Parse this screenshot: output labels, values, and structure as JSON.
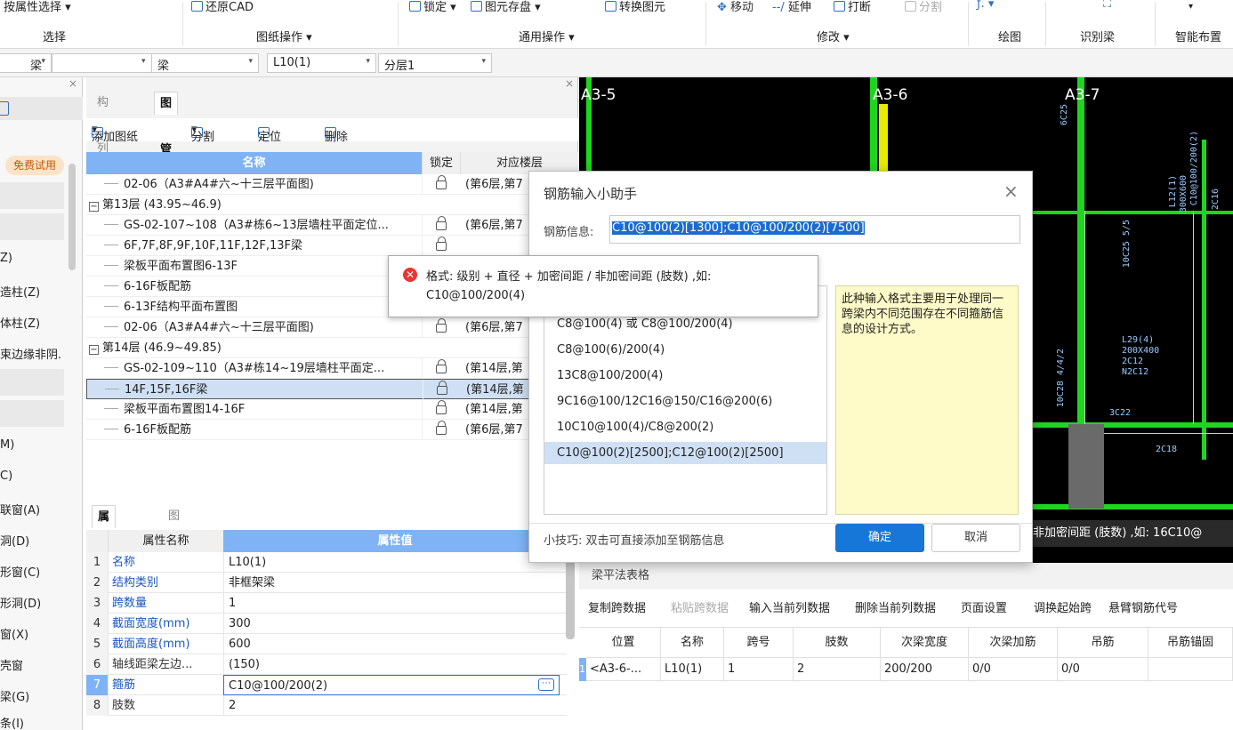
{
  "ribbon": {
    "groups": {
      "select": "选择",
      "drawing_ops": "图纸操作",
      "common_ops": "通用操作",
      "modify": "修改",
      "draw": "绘图",
      "recognize_beam": "识别梁",
      "smart_layout": "智能布置"
    },
    "buttons": {
      "attr_select": "按属性选择",
      "restore_cad": "还原CAD",
      "lock": "锁定",
      "save_element": "图元存盘",
      "convert_element": "转换图元",
      "move": "移动",
      "extend": "延伸",
      "break": "打断",
      "split": "分割"
    }
  },
  "combos": [
    "梁",
    "梁",
    "L10(1)",
    "分层1"
  ],
  "left_panel": {
    "badge": "免费试用",
    "items": [
      "Z)",
      "造柱(Z)",
      "体柱(Z)",
      "束边缘非阴.",
      "M)",
      "C)",
      "联窗(A)",
      "洞(D)",
      "形窗(C)",
      "形洞(D)",
      "窗(X)",
      "壳窗",
      "梁(G)",
      "条(I)"
    ]
  },
  "drawing_panel": {
    "tabs": [
      "构件列表",
      "图纸管理"
    ],
    "toolbar": {
      "add": "添加图纸",
      "split": "分割",
      "locate": "定位",
      "delete": "删除"
    },
    "headers": {
      "name": "名称",
      "lock": "锁定",
      "floor": "对应楼层"
    },
    "rows": [
      {
        "type": "item",
        "name": "02-06（A3#A4#六~十三层平面图)",
        "floor": "(第6层,第7"
      },
      {
        "type": "group",
        "name": "第13层 (43.95~46.9)",
        "floor": ""
      },
      {
        "type": "item",
        "name": "GS-02-107~108（A3#栋6~13层墙柱平面定位...",
        "floor": "(第6层,第7"
      },
      {
        "type": "item",
        "name": "6F,7F,8F,9F,10F,11F,12F,13F梁",
        "floor": ""
      },
      {
        "type": "item",
        "name": "梁板平面布置图6-13F",
        "floor": ""
      },
      {
        "type": "item",
        "name": "6-16F板配筋",
        "floor": ""
      },
      {
        "type": "item",
        "name": "6-13F结构平面布置图",
        "floor": "(第6层,第7"
      },
      {
        "type": "item",
        "name": "02-06（A3#A4#六~十三层平面图)",
        "floor": "(第6层,第7"
      },
      {
        "type": "group",
        "name": "第14层 (46.9~49.85)",
        "floor": ""
      },
      {
        "type": "item",
        "name": "GS-02-109~110（A3#栋14~19层墙柱平面定...",
        "floor": "(第14层,第"
      },
      {
        "type": "item",
        "name": "14F,15F,16F梁",
        "floor": "(第14层,第"
      },
      {
        "type": "item",
        "name": "梁板平面布置图14-16F",
        "floor": "(第14层,第"
      },
      {
        "type": "item",
        "name": "6-16F板配筋",
        "floor": "(第6层,第7"
      }
    ]
  },
  "property_panel": {
    "tabs": [
      "属性列表",
      "图层管理"
    ],
    "headers": {
      "name": "属性名称",
      "value": "属性值"
    },
    "rows": [
      {
        "n": "1",
        "name": "名称",
        "value": "L10(1)"
      },
      {
        "n": "2",
        "name": "结构类别",
        "value": "非框架梁"
      },
      {
        "n": "3",
        "name": "跨数量",
        "value": "1"
      },
      {
        "n": "4",
        "name": "截面宽度(mm)",
        "value": "300"
      },
      {
        "n": "5",
        "name": "截面高度(mm)",
        "value": "600"
      },
      {
        "n": "6",
        "name": "轴线距梁左边...",
        "value": "(150)"
      },
      {
        "n": "7",
        "name": "箍筋",
        "value": "C10@100/200(2)"
      },
      {
        "n": "8",
        "name": "肢数",
        "value": "2"
      }
    ]
  },
  "cad": {
    "axis_labels": [
      "A3-5",
      "A3-6",
      "A3-7"
    ],
    "annotations": [
      "6C25",
      "L12(1)",
      "300X600",
      "C10@100/200(2)",
      "2C16",
      "10C25 5/5",
      "L29(4)",
      "200X400",
      "2C12",
      "N2C12",
      "10C28 4/4/2",
      "3C22",
      "2C18"
    ],
    "status_overlay": "非加密间距 (肢数) ,如: 16C10@"
  },
  "beam_table": {
    "title": "梁平法表格",
    "toolbar": [
      "复制跨数据",
      "粘贴跨数据",
      "输入当前列数据",
      "删除当前列数据",
      "页面设置",
      "调换起始跨",
      "悬臂钢筋代号"
    ],
    "columns": [
      "位置",
      "名称",
      "跨号",
      "肢数",
      "次梁宽度",
      "次梁加筋",
      "吊筋",
      "吊筋锚固"
    ],
    "row_num": "1",
    "row": [
      "<A3-6-...",
      "L10(1)",
      "1",
      "2",
      "200/200",
      "0/0",
      "0/0",
      ""
    ]
  },
  "dialog": {
    "title": "钢筋输入小助手",
    "info_label": "钢筋信息:",
    "info_value": "C10@100(2)[1300];C10@100/200(2)[7500]",
    "examples": [
      "C8@100(4) 或 C8@100/200(4)",
      "C8@100(6)/200(4)",
      "13C8@100/200(4)",
      "9C16@100/12C16@150/C16@200(6)",
      "10C10@100(4)/C8@200(2)",
      "C10@100(2)[2500];C12@100(2)[2500]"
    ],
    "description": "此种输入格式主要用于处理同一跨梁内不同范围存在不同箍筋信息的设计方式。",
    "tip": "小技巧: 双击可直接添加至钢筋信息",
    "ok": "确定",
    "cancel": "取消"
  },
  "tooltip": {
    "line1": "格式: 级别 + 直径 + 加密间距 / 非加密间距 (肢数) ,如:",
    "line2": "C10@100/200(4)"
  },
  "colors": {
    "accent": "#1677d9",
    "selection": "#cfe0f5",
    "header_blue": "#7fb3f5",
    "cad_green": "#1ed61e",
    "note_yellow": "#fffbc8"
  }
}
